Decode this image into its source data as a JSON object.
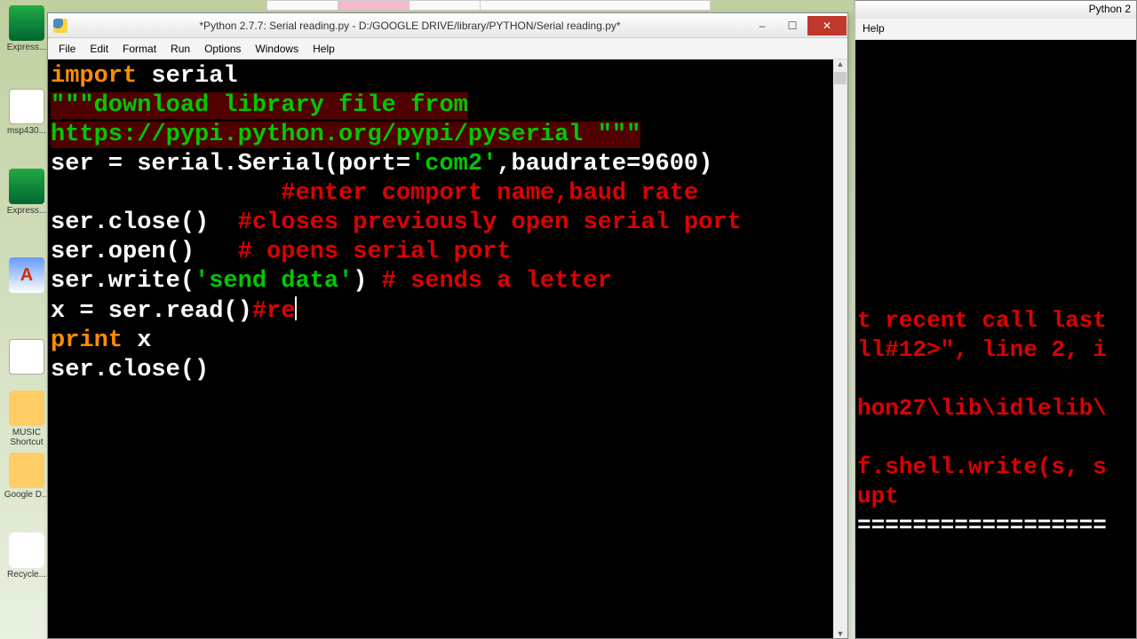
{
  "desktop_icons": {
    "expresspcb": "Express...",
    "msp430": "msp430...",
    "expresssch": "Express...",
    "a_letter": "A",
    "music": "MUSIC Shortcut",
    "gd": "Google D...",
    "rb": "Recycle..."
  },
  "main_window": {
    "title": "*Python 2.7.7: Serial reading.py - D:/GOOGLE DRIVE/library/PYTHON/Serial reading.py*",
    "menu": [
      "File",
      "Edit",
      "Format",
      "Run",
      "Options",
      "Windows",
      "Help"
    ]
  },
  "code": {
    "l1": {
      "kw": "import",
      "rest": " serial"
    },
    "l2": {
      "doc": "\"\"\"download library file from"
    },
    "l3": {
      "doc": "https://pypi.python.org/pypi/pyserial \"\"\""
    },
    "l4": {
      "a": "ser = serial.Serial(port=",
      "str": "'com2'",
      "b": ",baudrate=9600)"
    },
    "l5": {
      "pad": "                ",
      "cmt": "#enter comport name,baud rate"
    },
    "l6": {
      "a": "ser.close()  ",
      "cmt": "#closes previously open serial port"
    },
    "l7": {
      "a": "ser.open()   ",
      "cmt": "# opens serial port"
    },
    "l8": {
      "a": "ser.write(",
      "str": "'send data'",
      "b": ") ",
      "cmt": "# sends a letter"
    },
    "l9": {
      "a": "x = ser.read()",
      "cmt": "#re"
    },
    "l10": {
      "kw": "print",
      "rest": " x"
    },
    "l11": {
      "a": "ser.close()"
    }
  },
  "right_window": {
    "title_fragment": "Python 2",
    "menu": "Help",
    "lines": {
      "l1": "t recent call last",
      "l2": "ll#12>\", line 2, i",
      "l3": "",
      "l4": "hon27\\lib\\idlelib\\",
      "l5": "",
      "l6": "f.shell.write(s, s",
      "l7": "upt",
      "l8": "=================="
    }
  }
}
